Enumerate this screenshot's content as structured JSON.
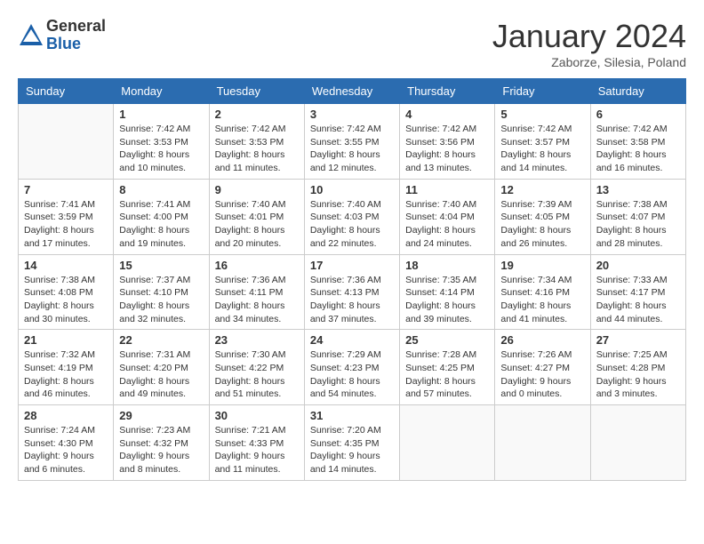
{
  "logo": {
    "general": "General",
    "blue": "Blue"
  },
  "title": "January 2024",
  "location": "Zaborze, Silesia, Poland",
  "days_of_week": [
    "Sunday",
    "Monday",
    "Tuesday",
    "Wednesday",
    "Thursday",
    "Friday",
    "Saturday"
  ],
  "weeks": [
    [
      {
        "day": "",
        "info": ""
      },
      {
        "day": "1",
        "info": "Sunrise: 7:42 AM\nSunset: 3:53 PM\nDaylight: 8 hours\nand 10 minutes."
      },
      {
        "day": "2",
        "info": "Sunrise: 7:42 AM\nSunset: 3:53 PM\nDaylight: 8 hours\nand 11 minutes."
      },
      {
        "day": "3",
        "info": "Sunrise: 7:42 AM\nSunset: 3:55 PM\nDaylight: 8 hours\nand 12 minutes."
      },
      {
        "day": "4",
        "info": "Sunrise: 7:42 AM\nSunset: 3:56 PM\nDaylight: 8 hours\nand 13 minutes."
      },
      {
        "day": "5",
        "info": "Sunrise: 7:42 AM\nSunset: 3:57 PM\nDaylight: 8 hours\nand 14 minutes."
      },
      {
        "day": "6",
        "info": "Sunrise: 7:42 AM\nSunset: 3:58 PM\nDaylight: 8 hours\nand 16 minutes."
      }
    ],
    [
      {
        "day": "7",
        "info": "Sunrise: 7:41 AM\nSunset: 3:59 PM\nDaylight: 8 hours\nand 17 minutes."
      },
      {
        "day": "8",
        "info": "Sunrise: 7:41 AM\nSunset: 4:00 PM\nDaylight: 8 hours\nand 19 minutes."
      },
      {
        "day": "9",
        "info": "Sunrise: 7:40 AM\nSunset: 4:01 PM\nDaylight: 8 hours\nand 20 minutes."
      },
      {
        "day": "10",
        "info": "Sunrise: 7:40 AM\nSunset: 4:03 PM\nDaylight: 8 hours\nand 22 minutes."
      },
      {
        "day": "11",
        "info": "Sunrise: 7:40 AM\nSunset: 4:04 PM\nDaylight: 8 hours\nand 24 minutes."
      },
      {
        "day": "12",
        "info": "Sunrise: 7:39 AM\nSunset: 4:05 PM\nDaylight: 8 hours\nand 26 minutes."
      },
      {
        "day": "13",
        "info": "Sunrise: 7:38 AM\nSunset: 4:07 PM\nDaylight: 8 hours\nand 28 minutes."
      }
    ],
    [
      {
        "day": "14",
        "info": "Sunrise: 7:38 AM\nSunset: 4:08 PM\nDaylight: 8 hours\nand 30 minutes."
      },
      {
        "day": "15",
        "info": "Sunrise: 7:37 AM\nSunset: 4:10 PM\nDaylight: 8 hours\nand 32 minutes."
      },
      {
        "day": "16",
        "info": "Sunrise: 7:36 AM\nSunset: 4:11 PM\nDaylight: 8 hours\nand 34 minutes."
      },
      {
        "day": "17",
        "info": "Sunrise: 7:36 AM\nSunset: 4:13 PM\nDaylight: 8 hours\nand 37 minutes."
      },
      {
        "day": "18",
        "info": "Sunrise: 7:35 AM\nSunset: 4:14 PM\nDaylight: 8 hours\nand 39 minutes."
      },
      {
        "day": "19",
        "info": "Sunrise: 7:34 AM\nSunset: 4:16 PM\nDaylight: 8 hours\nand 41 minutes."
      },
      {
        "day": "20",
        "info": "Sunrise: 7:33 AM\nSunset: 4:17 PM\nDaylight: 8 hours\nand 44 minutes."
      }
    ],
    [
      {
        "day": "21",
        "info": "Sunrise: 7:32 AM\nSunset: 4:19 PM\nDaylight: 8 hours\nand 46 minutes."
      },
      {
        "day": "22",
        "info": "Sunrise: 7:31 AM\nSunset: 4:20 PM\nDaylight: 8 hours\nand 49 minutes."
      },
      {
        "day": "23",
        "info": "Sunrise: 7:30 AM\nSunset: 4:22 PM\nDaylight: 8 hours\nand 51 minutes."
      },
      {
        "day": "24",
        "info": "Sunrise: 7:29 AM\nSunset: 4:23 PM\nDaylight: 8 hours\nand 54 minutes."
      },
      {
        "day": "25",
        "info": "Sunrise: 7:28 AM\nSunset: 4:25 PM\nDaylight: 8 hours\nand 57 minutes."
      },
      {
        "day": "26",
        "info": "Sunrise: 7:26 AM\nSunset: 4:27 PM\nDaylight: 9 hours\nand 0 minutes."
      },
      {
        "day": "27",
        "info": "Sunrise: 7:25 AM\nSunset: 4:28 PM\nDaylight: 9 hours\nand 3 minutes."
      }
    ],
    [
      {
        "day": "28",
        "info": "Sunrise: 7:24 AM\nSunset: 4:30 PM\nDaylight: 9 hours\nand 6 minutes."
      },
      {
        "day": "29",
        "info": "Sunrise: 7:23 AM\nSunset: 4:32 PM\nDaylight: 9 hours\nand 8 minutes."
      },
      {
        "day": "30",
        "info": "Sunrise: 7:21 AM\nSunset: 4:33 PM\nDaylight: 9 hours\nand 11 minutes."
      },
      {
        "day": "31",
        "info": "Sunrise: 7:20 AM\nSunset: 4:35 PM\nDaylight: 9 hours\nand 14 minutes."
      },
      {
        "day": "",
        "info": ""
      },
      {
        "day": "",
        "info": ""
      },
      {
        "day": "",
        "info": ""
      }
    ]
  ]
}
